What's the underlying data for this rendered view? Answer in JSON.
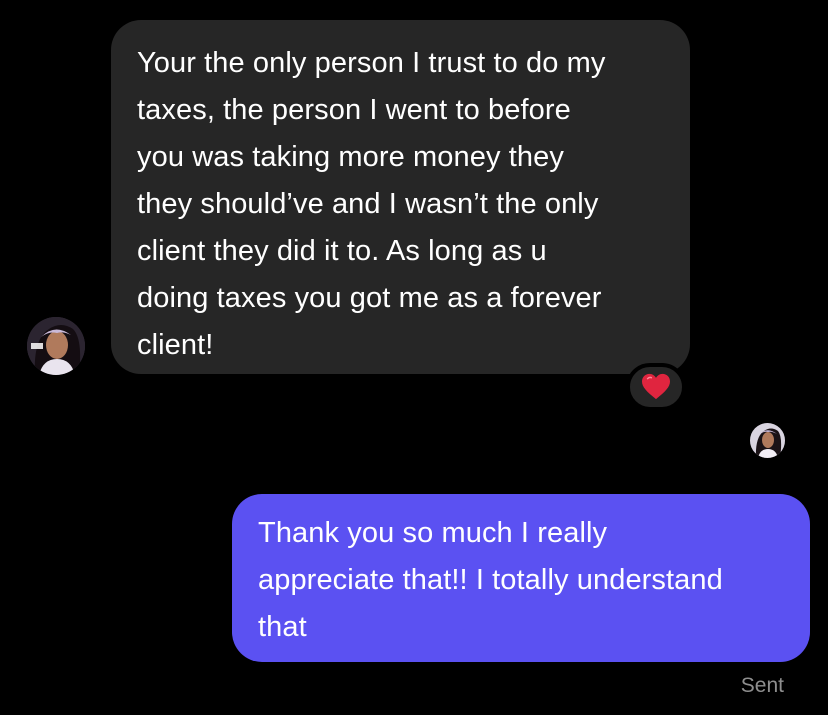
{
  "conversation": {
    "incoming": {
      "lines": [
        "Your the only person I trust to do my",
        "taxes, the person I went to before",
        "you was taking more money they",
        "they should’ve and I wasn’t the only",
        "client they did it to. As long as u",
        "doing taxes you got me as a forever",
        "client!"
      ],
      "reaction_icon": "heart-icon",
      "reaction_color": "#e0253f",
      "bubble_color": "#262626"
    },
    "outgoing": {
      "lines": [
        "Thank you so much I really",
        "appreciate that!! I totally understand",
        "that"
      ],
      "status": "Sent",
      "bubble_color": "#5b51f2"
    }
  },
  "colors": {
    "background": "#000000",
    "text": "#ffffff",
    "status_text": "#8e8e8e"
  }
}
